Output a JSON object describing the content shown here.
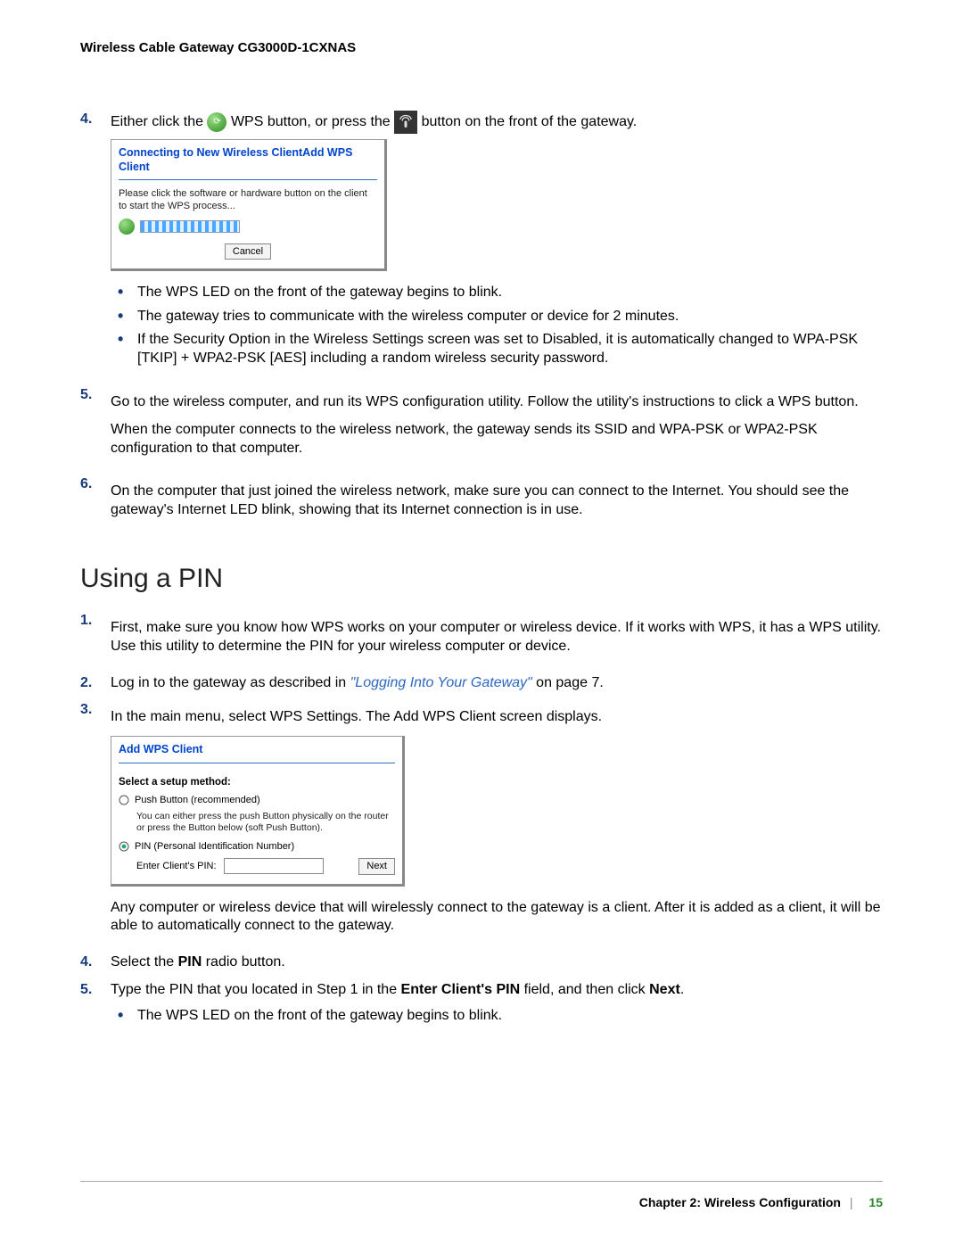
{
  "header": {
    "doc_title": "Wireless Cable Gateway CG3000D-1CXNAS"
  },
  "steps_a": {
    "s4": {
      "num": "4.",
      "t1": "Either click the ",
      "t2": " WPS button, or press the ",
      "t3": " button on the front of the gateway."
    },
    "s5": {
      "num": "5.",
      "p1": "Go to the wireless computer, and run its WPS configuration utility. Follow the utility's instructions to click a WPS button.",
      "p2": "When the computer connects to the wireless network, the gateway sends its SSID and WPA-PSK or WPA2-PSK configuration to that computer."
    },
    "s6": {
      "num": "6.",
      "p1": "On the computer that just joined the wireless network, make sure you can connect to the Internet. You should see the gateway's Internet LED blink, showing that its Internet connection is in use."
    }
  },
  "bullets_a": {
    "b1": "The WPS LED on the front of the gateway begins to blink.",
    "b2": "The gateway tries to communicate with the wireless computer or device for 2 minutes.",
    "b3": "If the Security Option in the Wireless Settings screen was set to Disabled, it is automatically changed to WPA-PSK [TKIP] + WPA2-PSK [AES] including a random wireless security password."
  },
  "section_heading": "Using a PIN",
  "steps_b": {
    "s1": {
      "num": "1.",
      "p": "First, make sure you know how WPS works on your computer or wireless device. If it works with WPS, it has a WPS utility. Use this utility to determine the PIN for your wireless computer or device."
    },
    "s2": {
      "num": "2.",
      "t1": "Log in to the gateway as described in ",
      "link": "\"Logging Into Your Gateway\"",
      "t2": " on page 7."
    },
    "s3": {
      "num": "3.",
      "p": "In the main menu, select WPS Settings. The Add WPS Client screen displays."
    },
    "after_ss": "Any computer or wireless device that will wirelessly connect to the gateway is a client. After it is added as a client, it will be able to automatically connect to the gateway.",
    "s4": {
      "num": "4.",
      "t1": "Select the ",
      "b": "PIN",
      "t2": " radio button."
    },
    "s5": {
      "num": "5.",
      "t1": "Type the PIN that you located in Step 1 in the ",
      "b1": "Enter Client's PIN",
      "t2": " field, and then click ",
      "b2": "Next",
      "t3": "."
    }
  },
  "bullets_b": {
    "b1": "The WPS LED on the front of the gateway begins to blink."
  },
  "screenshot1": {
    "title": "Connecting to New Wireless ClientAdd WPS Client",
    "text": "Please click the software or hardware button on the client to start the WPS process...",
    "cancel": "Cancel"
  },
  "screenshot2": {
    "title": "Add WPS Client",
    "label": "Select a setup method:",
    "opt1": "Push Button (recommended)",
    "opt1_sub": "You can either press the push Button physically on the router or press the Button below (soft Push Button).",
    "opt2": "PIN (Personal Identification Number)",
    "pin_label": "Enter Client's PIN:",
    "next": "Next"
  },
  "footer": {
    "chapter": "Chapter 2:  Wireless Configuration",
    "page": "15"
  }
}
